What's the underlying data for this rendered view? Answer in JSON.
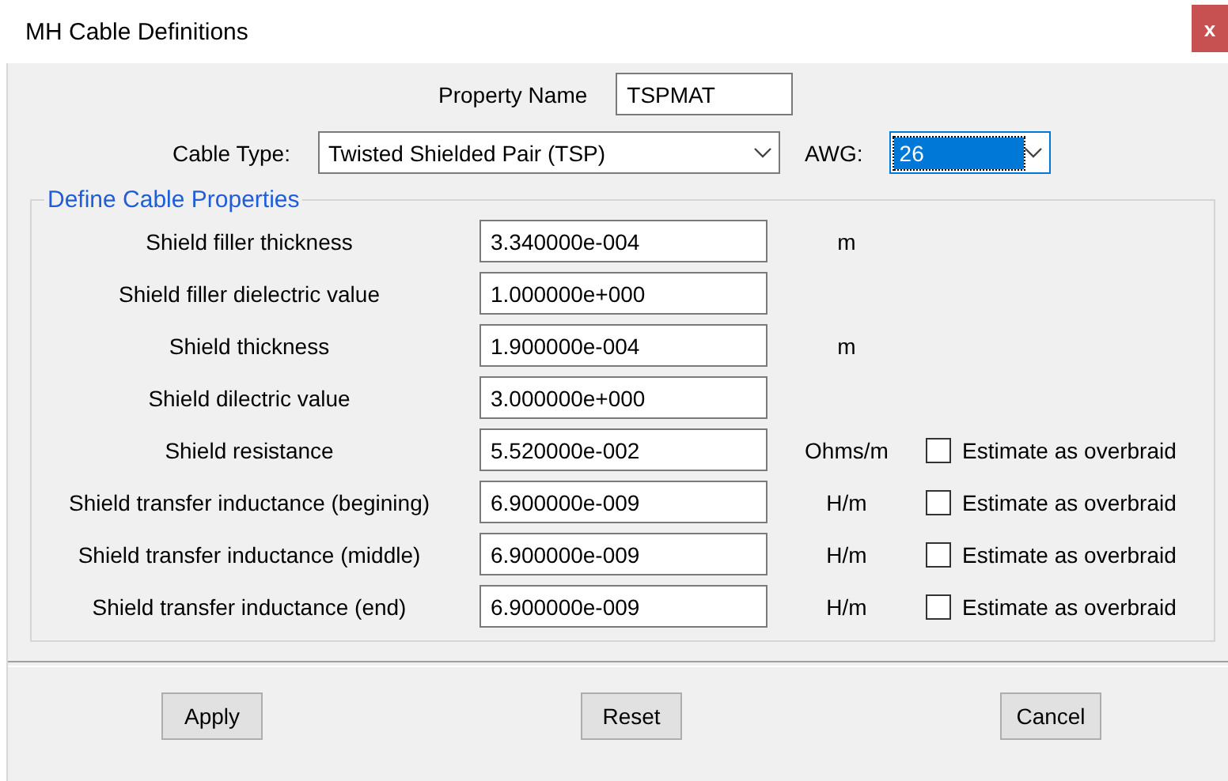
{
  "window": {
    "title": "MH Cable Definitions",
    "close": "x"
  },
  "property_name": {
    "label": "Property Name",
    "value": "TSPMAT"
  },
  "cable_type": {
    "label": "Cable Type:",
    "value": "Twisted Shielded Pair (TSP)"
  },
  "awg": {
    "label": "AWG:",
    "value": "26",
    "focused": true
  },
  "group": {
    "title": "Define Cable Properties",
    "rows": [
      {
        "label": "Shield filler thickness",
        "value": "3.340000e-004",
        "unit": "m"
      },
      {
        "label": "Shield filler dielectric value",
        "value": "1.000000e+000"
      },
      {
        "label": "Shield thickness",
        "value": "1.900000e-004",
        "unit": "m"
      },
      {
        "label": "Shield dilectric value",
        "value": "3.000000e+000"
      },
      {
        "label": "Shield resistance",
        "value": "5.520000e-002",
        "unit": "Ohms/m",
        "checkbox": {
          "label": "Estimate as overbraid",
          "checked": false
        }
      },
      {
        "label": "Shield transfer inductance (begining)",
        "value": "6.900000e-009",
        "unit": "H/m",
        "checkbox": {
          "label": "Estimate as overbraid",
          "checked": false
        }
      },
      {
        "label": "Shield transfer inductance (middle)",
        "value": "6.900000e-009",
        "unit": "H/m",
        "checkbox": {
          "label": "Estimate as overbraid",
          "checked": false
        }
      },
      {
        "label": "Shield transfer inductance (end)",
        "value": "6.900000e-009",
        "unit": "H/m",
        "checkbox": {
          "label": "Estimate as overbraid",
          "checked": false
        }
      }
    ]
  },
  "buttons": [
    "Apply",
    "Reset",
    "Cancel"
  ]
}
